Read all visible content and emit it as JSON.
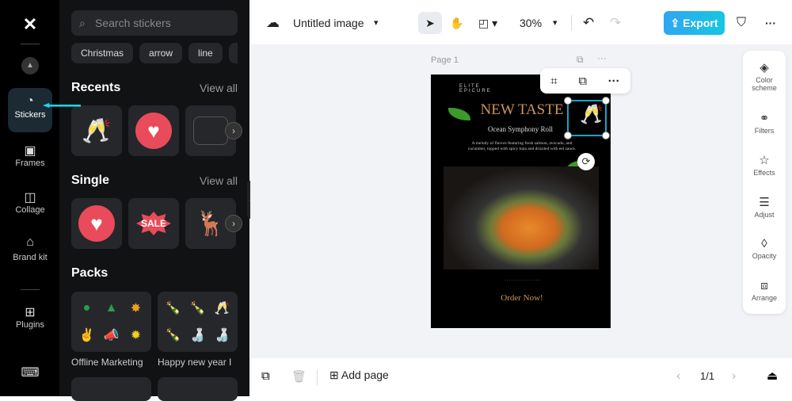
{
  "rail": {
    "items": [
      {
        "label": "Stickers",
        "icon": "sticker-icon"
      },
      {
        "label": "Frames",
        "icon": "frame-icon"
      },
      {
        "label": "Collage",
        "icon": "collage-icon"
      },
      {
        "label": "Brand kit",
        "icon": "brand-kit-icon"
      },
      {
        "label": "Plugins",
        "icon": "plugins-icon"
      }
    ],
    "active": "Stickers"
  },
  "panel": {
    "search_placeholder": "Search stickers",
    "chips": [
      "Christmas",
      "arrow",
      "line"
    ],
    "recents": {
      "title": "Recents",
      "view_all": "View all"
    },
    "single": {
      "title": "Single",
      "view_all": "View all",
      "sale": "SALE"
    },
    "packs": {
      "title": "Packs",
      "items": [
        "Offline Marketing",
        "Happy new year I"
      ]
    }
  },
  "topbar": {
    "title": "Untitled image",
    "zoom": "30%",
    "export": "Export"
  },
  "canvas": {
    "page_label": "Page 1"
  },
  "poster": {
    "brand": "ELITE EPICURE",
    "headline": "NEW TASTE",
    "subtitle": "Ocean Symphony Roll",
    "description": "A melody of flavors featuring fresh salmon, avocado, and cucumber, topped with spicy tuna and drizzled with eel sauce.",
    "cta": "Order Now!"
  },
  "right_panel": [
    "Color scheme",
    "Filters",
    "Effects",
    "Adjust",
    "Opacity",
    "Arrange"
  ],
  "bottombar": {
    "add_page": "Add page",
    "page_count": "1/1"
  },
  "colors": {
    "accent": "#17c6e0",
    "selection": "#1aa3c4",
    "poster_gold": "#c8955a"
  }
}
